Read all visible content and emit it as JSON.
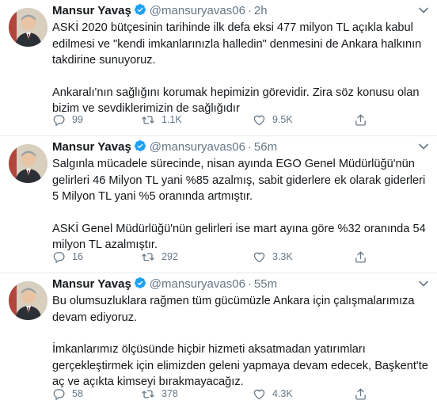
{
  "account": {
    "name": "Mansur Yavaş",
    "handle": "@mansuryavas06"
  },
  "tweets": [
    {
      "time": "2h",
      "paragraphs": [
        "ASKİ 2020 bütçesinin tarihinde ilk defa eksi 477 milyon TL açıkla kabul edilmesi ve \"kendi imkanlarınızla halledin\" denmesini de Ankara halkının takdirine sunuyoruz.",
        "Ankaralı'nın sağlığını korumak hepimizin görevidir. Zira söz konusu olan bizim ve sevdiklerimizin de sağlığıdır"
      ],
      "replies": "99",
      "retweets": "1.1K",
      "likes": "9.5K"
    },
    {
      "time": "56m",
      "paragraphs": [
        "Salgınla mücadele sürecinde, nisan ayında EGO Genel Müdürlüğü'nün gelirleri 46 Milyon TL yani %85 azalmış, sabit giderlere ek olarak giderleri 5 Milyon TL yani %5 oranında artmıştır.",
        "ASKİ Genel Müdürlüğü'nün gelirleri ise mart ayına göre %32 oranında 54 milyon TL azalmıştır."
      ],
      "replies": "16",
      "retweets": "292",
      "likes": "3.3K"
    },
    {
      "time": "55m",
      "paragraphs": [
        "Bu olumsuzluklara rağmen tüm gücümüzle Ankara için çalışmalarımıza devam ediyoruz.",
        "İmkanlarımız ölçüsünde hiçbir hizmeti aksatmadan yatırımları gerçekleştirmek için elimizden geleni yapmaya devam edecek, Başkent'te aç ve açıkta kimseyi bırakmayacağız."
      ],
      "replies": "58",
      "retweets": "378",
      "likes": "4.3K"
    }
  ],
  "colors": {
    "accent": "#1da1f2",
    "muted": "#657786",
    "text": "#14171a",
    "divider": "#e6ecf0"
  },
  "icons": [
    "avatar-photo",
    "verified-badge-icon",
    "chevron-down-icon",
    "reply-icon",
    "retweet-icon",
    "like-icon",
    "share-icon"
  ]
}
